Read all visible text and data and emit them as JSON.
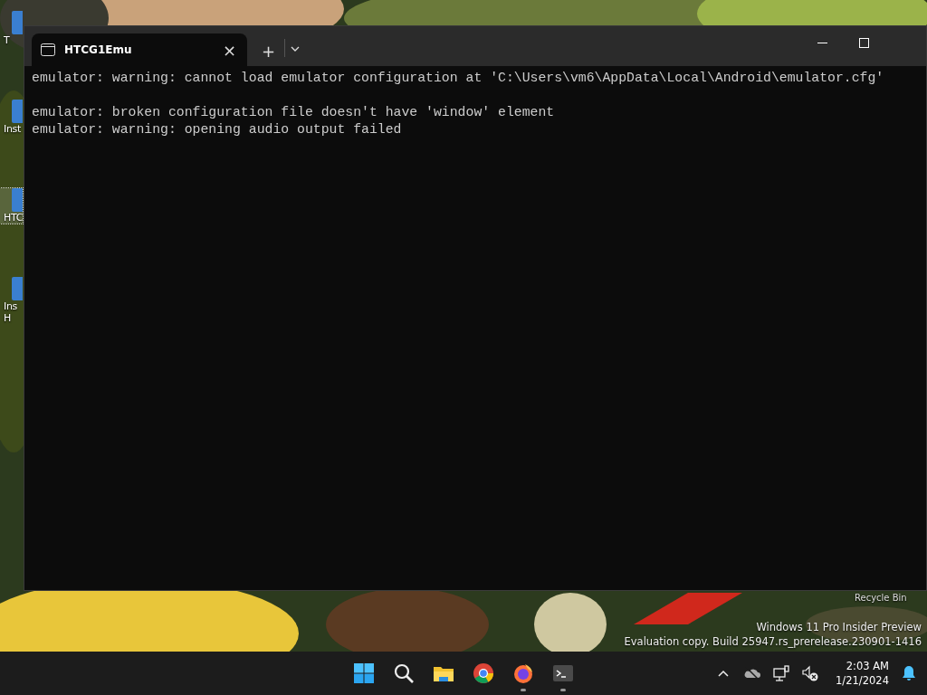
{
  "desktop": {
    "icons": [
      {
        "label": "T"
      },
      {
        "label": "Inst"
      },
      {
        "label": "HTC",
        "selected": true
      },
      {
        "label": "Ins",
        "label_line2": "H"
      }
    ],
    "recycle_bin": {
      "label": "Recycle Bin"
    },
    "watermark": [
      "Windows 11 Pro Insider Preview",
      "Evaluation copy. Build 25947.rs_prerelease.230901-1416"
    ]
  },
  "window": {
    "tabs": [
      {
        "title": "HTCG1Emu",
        "selected": true,
        "close": "×"
      }
    ],
    "new_tab": "+",
    "output": [
      [
        "emulator: warning: cannot load emulator configuration at 'C:\\Users\\vm6\\AppData\\Local\\Android\\emulator.cfg'"
      ],
      [
        "emulator: broken configuration file doesn't have 'window' element",
        "emulator: warning: opening audio output failed"
      ]
    ]
  },
  "taskbar": {
    "apps": [
      {
        "kind": "start",
        "running": false
      },
      {
        "kind": "search",
        "running": false
      },
      {
        "kind": "folder",
        "running": false
      },
      {
        "kind": "chrome",
        "running": false
      },
      {
        "kind": "firefox",
        "running": true
      },
      {
        "kind": "terminal",
        "running": true
      }
    ],
    "time": "2:03 AM",
    "date": "1/21/2024"
  }
}
